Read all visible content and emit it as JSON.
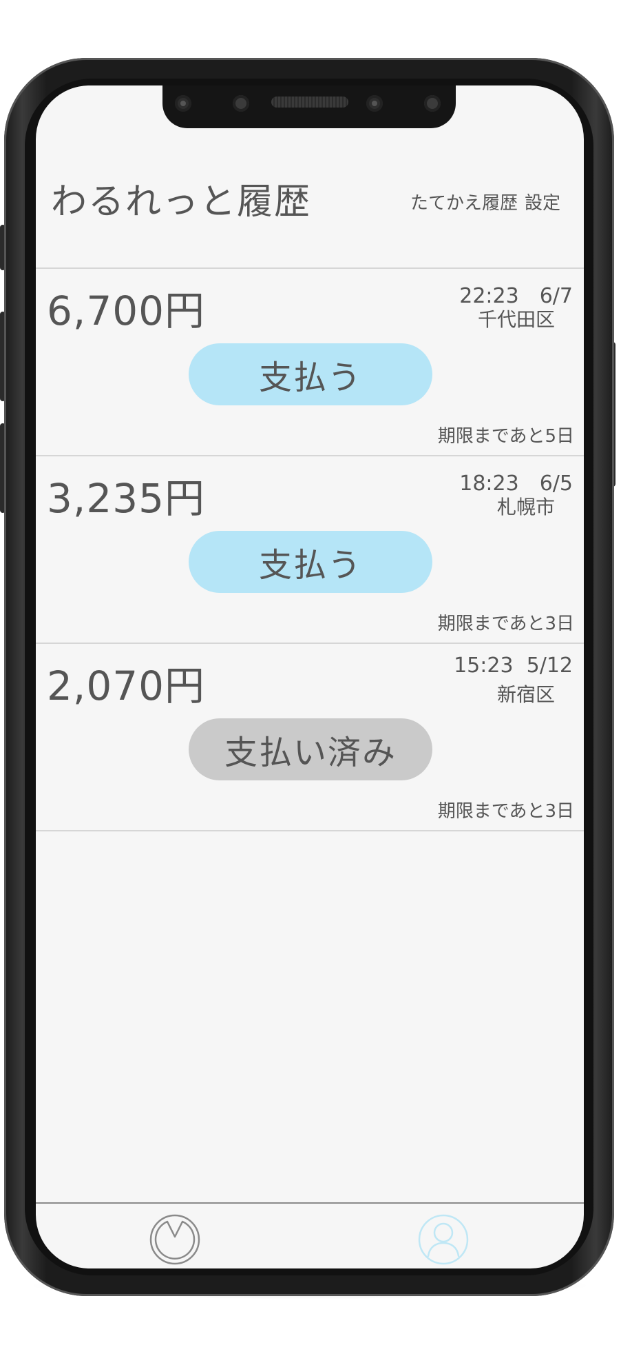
{
  "app": {
    "title": "わるれっと履歴",
    "links": {
      "exchange_history": "たてかえ履歴",
      "settings": "設定"
    }
  },
  "entries": [
    {
      "amount": "6,700円",
      "time_date": "22:23　6/7",
      "place": "千代田区",
      "button_label": "支払う",
      "status": "unpaid",
      "deadline": "期限まであと5日"
    },
    {
      "amount": "3,235円",
      "time_date": "18:23　6/5",
      "place": "札幌市",
      "button_label": "支払う",
      "status": "unpaid",
      "deadline": "期限まであと3日"
    },
    {
      "amount": "2,070円",
      "time_date": "15:23  5/12",
      "place": "新宿区",
      "button_label": "支払い済み",
      "status": "paid",
      "deadline": "期限まであと3日"
    }
  ],
  "tabbar": {
    "left_icon": "wallet-history-icon",
    "right_icon": "user-profile-icon",
    "active_color": "#bfe7f5",
    "inactive_color": "#8a8a8a"
  },
  "colors": {
    "unpaid_button": "#b5e5f7",
    "paid_button": "#cacaca",
    "text": "#555555",
    "screen_bg": "#f6f6f6"
  }
}
